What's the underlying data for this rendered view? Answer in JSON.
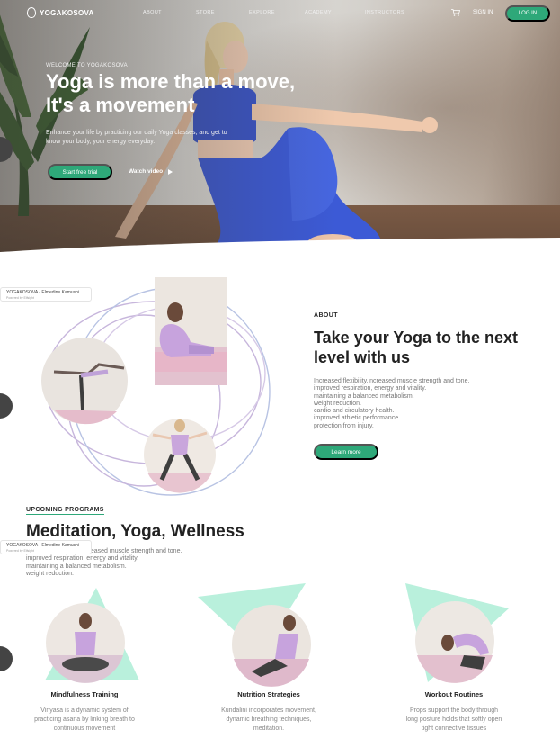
{
  "brand": {
    "name": "YOGAKOSOVA"
  },
  "nav": {
    "links": [
      "ABOUT",
      "STORE",
      "EXPLORE",
      "ACADEMY",
      "INSTRUCTORS"
    ],
    "sign_in": "SIGN IN",
    "log_in": "LOG IN",
    "cart_icon": "cart-icon"
  },
  "hero": {
    "eyebrow": "WELCOME TO YOGAKOSOVA",
    "title_line1": "Yoga is more than a move,",
    "title_line2": "It's a movement",
    "description": "Enhance your life by practicing our daily Yoga classes, and get to know your body, your energy everyday.",
    "cta": "Start free trial",
    "watch": "Watch video",
    "play_icon": "play-icon"
  },
  "widget": {
    "title": "YOGAKOSOVA - Elmedine Kamushi",
    "subtitle": "Powered by Elfsight"
  },
  "about": {
    "label": "ABOUT",
    "title": "Take your Yoga to the next level with us",
    "benefits": [
      "Increased flexibility,increased muscle strength and tone.",
      "improved respiration, energy and vitality.",
      "maintaining a balanced metabolism.",
      "weight reduction.",
      "cardio and circulatory health.",
      "improved athletic performance.",
      "protection from injury."
    ],
    "cta": "Learn more"
  },
  "programs": {
    "label": "UPCOMING PROGRAMS",
    "title": "Meditation, Yoga, Wellness",
    "benefits": [
      "Increased flexibility,increased muscle strength and tone.",
      "improved respiration, energy and vitality.",
      "maintaining a balanced metabolism.",
      "weight reduction."
    ],
    "cards": [
      {
        "name": "Mindfulness Training",
        "desc_line1": "Vinyasa is a dynamic system of",
        "desc_line2": "practicing asana by linking breath to",
        "desc_line3": "continuous movement"
      },
      {
        "name": "Nutrition Strategies",
        "desc_line1": "Kundalini incorporates movement,",
        "desc_line2": "dynamic breathing techniques,",
        "desc_line3": "meditation."
      },
      {
        "name": "Workout Routines",
        "desc_line1": "Props support the body through",
        "desc_line2": "long posture holds that softly open",
        "desc_line3": "tight connective tissues"
      }
    ]
  },
  "colors": {
    "accent": "#2ea879",
    "mint": "#b9f0dc",
    "lilac": "#c9b3d9",
    "pink_mat": "#e6b3c3"
  }
}
